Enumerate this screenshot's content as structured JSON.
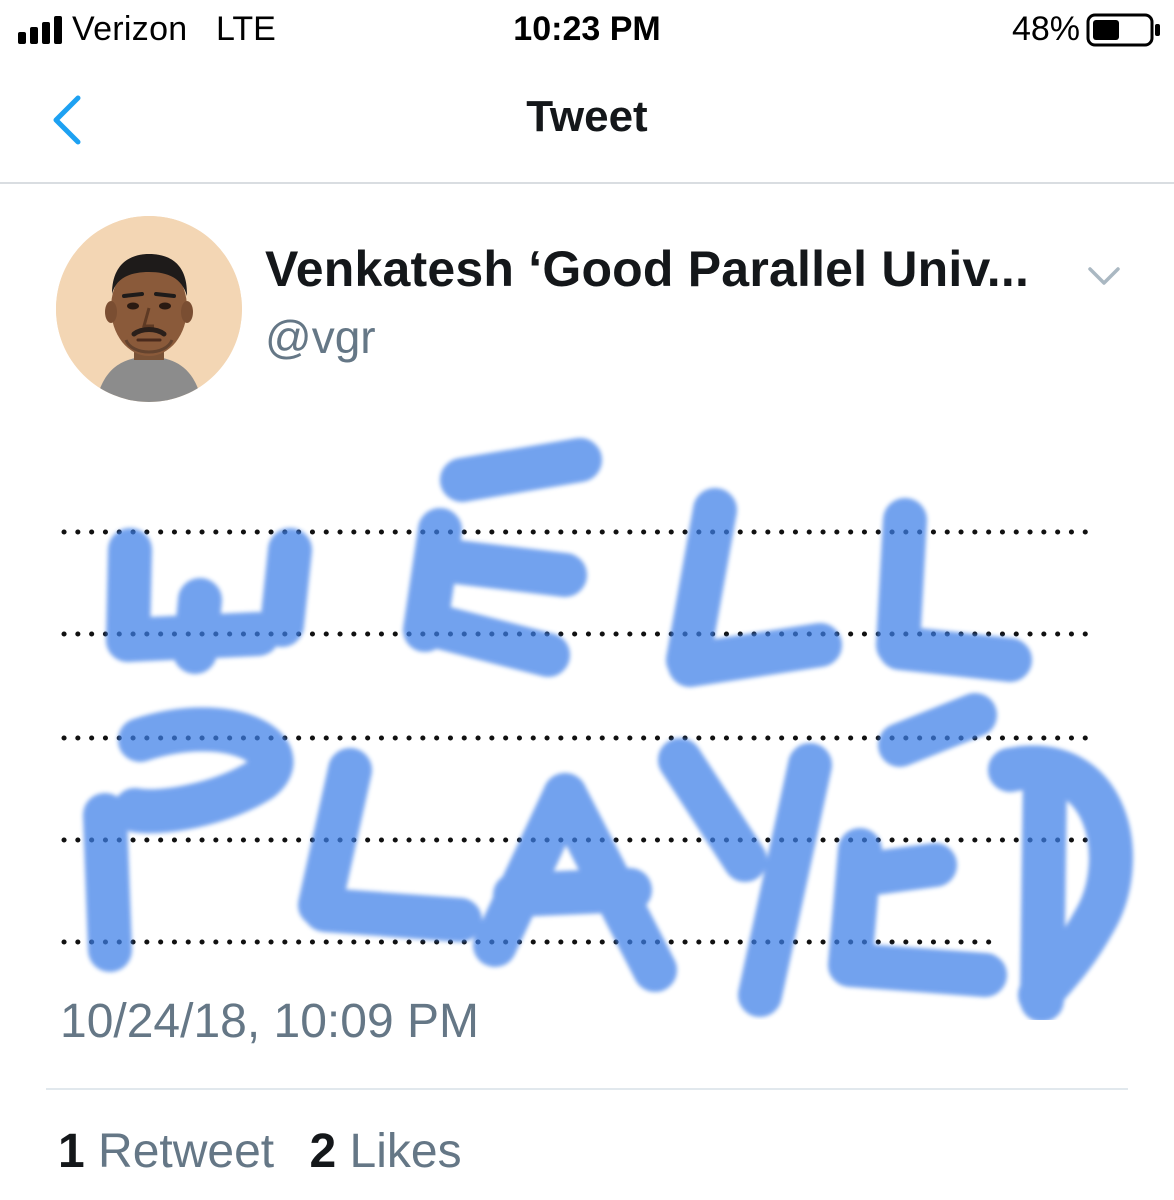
{
  "status_bar": {
    "carrier": "Verizon",
    "network": "LTE",
    "time": "10:23 PM",
    "battery_percent": "48%",
    "battery_level": 0.48
  },
  "nav": {
    "title": "Tweet",
    "back_icon": "chevron-left-icon"
  },
  "tweet": {
    "author": {
      "display_name": "Venkatesh ‘Good Parallel Univ...",
      "handle": "@vgr"
    },
    "image": {
      "handwritten_text": "WELL PLAYED",
      "ink_color": "#3d7fe8"
    },
    "timestamp": "10/24/18, 10:09 PM",
    "stats": {
      "retweet_count": "1",
      "retweet_label": "Retweet",
      "like_count": "2",
      "like_label": "Likes"
    }
  },
  "colors": {
    "accent": "#1da1f2",
    "secondary_text": "#657786",
    "primary_text": "#14171a"
  }
}
